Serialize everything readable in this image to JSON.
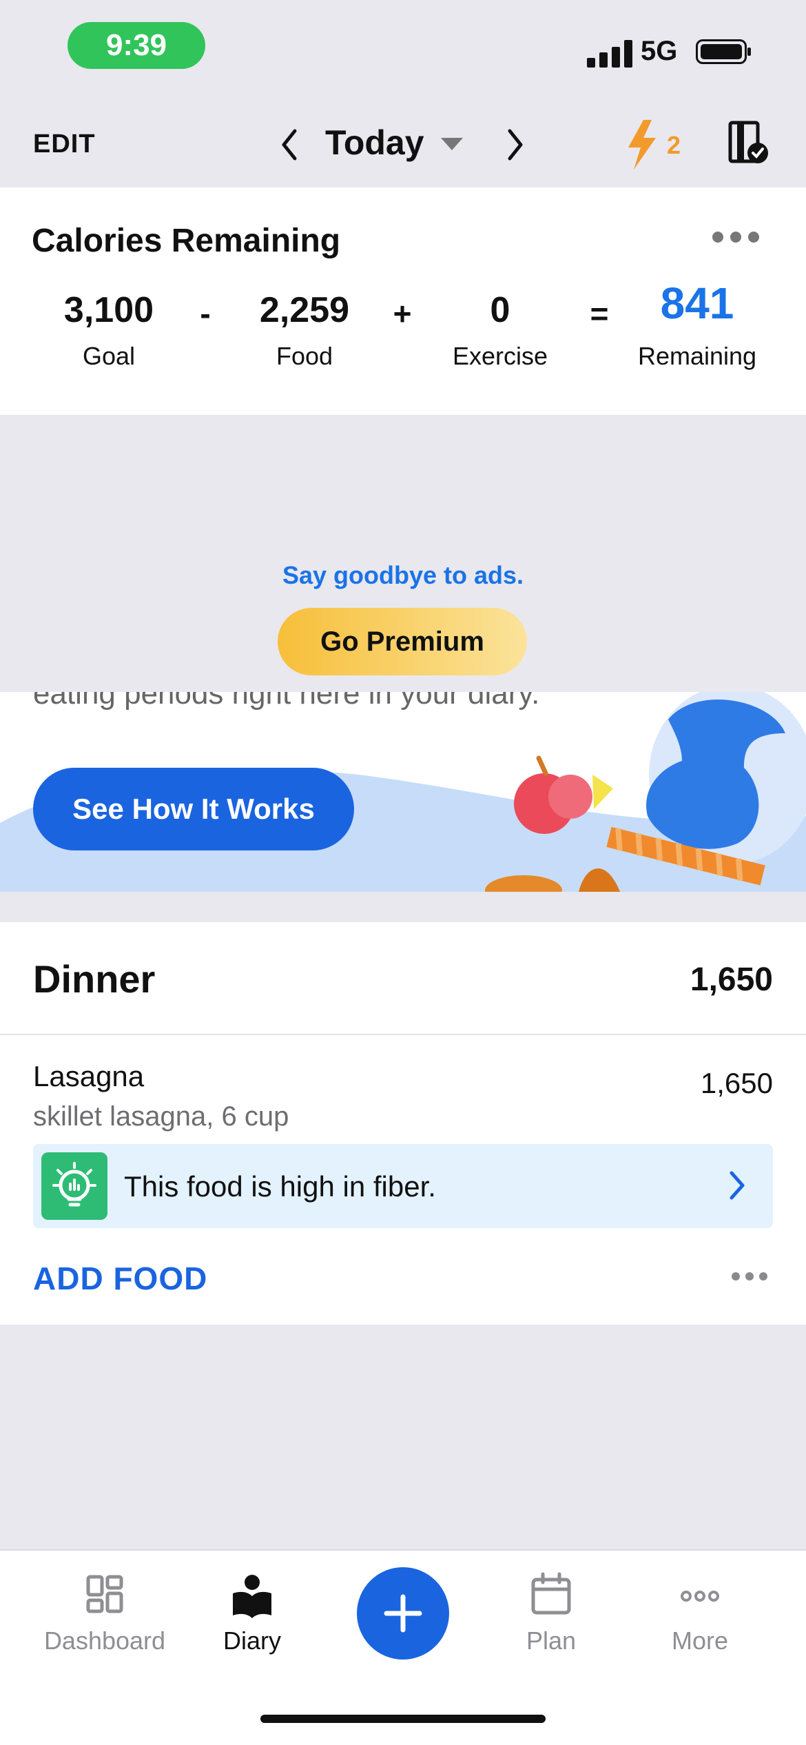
{
  "status_bar": {
    "time": "9:39",
    "network": "5G"
  },
  "header": {
    "edit_label": "EDIT",
    "date_label": "Today",
    "streak_count": "2"
  },
  "calories": {
    "title": "Calories Remaining",
    "goal": "3,100",
    "goal_label": "Goal",
    "op1": "-",
    "food": "2,259",
    "food_label": "Food",
    "op2": "+",
    "exercise": "0",
    "exercise_label": "Exercise",
    "op3": "=",
    "remaining": "841",
    "remaining_label": "Remaining"
  },
  "ad": {
    "text": "Say goodbye to ads.",
    "button": "Go Premium"
  },
  "promo": {
    "text": "eating periods right here in your diary.",
    "button": "See How It Works"
  },
  "dinner": {
    "title": "Dinner",
    "total": "1,650",
    "food": {
      "name": "Lasagna",
      "desc": "skillet lasagna, 6 cup",
      "calories": "1,650"
    },
    "tip": "This food is high in fiber.",
    "add_food": "ADD FOOD"
  },
  "tabs": [
    {
      "label": "Dashboard",
      "icon": "dashboard-icon"
    },
    {
      "label": "Diary",
      "icon": "diary-icon"
    },
    {
      "label": "Plan",
      "icon": "calendar-icon"
    },
    {
      "label": "More",
      "icon": "more-icon"
    }
  ],
  "colors": {
    "accent": "#1a64e0",
    "remaining": "#1a73e8",
    "premium": "#f7bf3a",
    "streak": "#f39a2c",
    "status_pill": "#31c45a"
  }
}
